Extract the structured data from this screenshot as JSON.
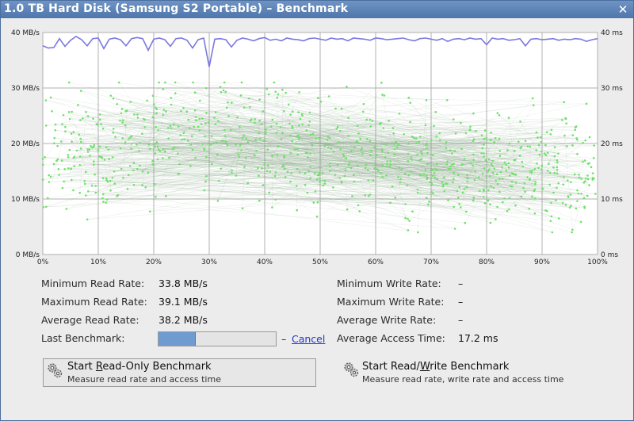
{
  "window": {
    "title": "1.0 TB Hard Disk (Samsung S2 Portable) – Benchmark",
    "close_icon": "close-icon"
  },
  "chart_data": {
    "type": "line",
    "x_ticks": [
      "0%",
      "10%",
      "20%",
      "30%",
      "40%",
      "50%",
      "60%",
      "70%",
      "80%",
      "90%",
      "100%"
    ],
    "y_left_ticks": [
      "0 MB/s",
      "10 MB/s",
      "20 MB/s",
      "30 MB/s",
      "40 MB/s"
    ],
    "y_right_ticks": [
      "0 ms",
      "10 ms",
      "20 ms",
      "30 ms",
      "40 ms"
    ],
    "xlim": [
      0,
      100
    ],
    "ylim_left": [
      0,
      40
    ],
    "ylim_right": [
      0,
      40
    ],
    "grid": true,
    "series": [
      {
        "kind": "read-rate-line",
        "color": "#7a78e0",
        "values": [
          37.6,
          37.2,
          37.3,
          38.9,
          37.5,
          38.6,
          39.3,
          38.7,
          37.6,
          38.9,
          39.0,
          37.1,
          38.8,
          39.0,
          38.7,
          37.6,
          38.9,
          39.1,
          38.9,
          36.8,
          38.8,
          39.0,
          38.7,
          37.5,
          38.9,
          39.0,
          38.6,
          37.2,
          38.7,
          39.0,
          33.8,
          38.8,
          38.9,
          38.7,
          37.4,
          38.6,
          39.0,
          38.8,
          38.5,
          38.9,
          39.1,
          38.6,
          38.8,
          38.5,
          39.0,
          38.8,
          38.7,
          38.5,
          38.9,
          39.0,
          38.8,
          38.6,
          39.0,
          38.8,
          38.9,
          38.5,
          39.0,
          38.9,
          38.8,
          38.6,
          39.0,
          38.9,
          38.7,
          38.8,
          38.9,
          39.0,
          38.7,
          38.5,
          38.9,
          39.0,
          38.8,
          38.6,
          38.9,
          38.4,
          38.8,
          38.9,
          38.7,
          39.0,
          38.8,
          38.9,
          37.8,
          39.0,
          38.8,
          38.9,
          38.6,
          38.7,
          38.9,
          37.6,
          38.8,
          38.9,
          38.7,
          38.8,
          38.9,
          38.6,
          38.8,
          38.7,
          38.9,
          38.8,
          38.4,
          38.7,
          38.9
        ]
      },
      {
        "kind": "access-time-scatter",
        "color": "#6fe06a",
        "description_values": "access times mostly between 8 ms and 30 ms"
      }
    ]
  },
  "stats": {
    "min_read_label": "Minimum Read Rate:",
    "min_read_value": "33.8 MB/s",
    "max_read_label": "Maximum Read Rate:",
    "max_read_value": "39.1 MB/s",
    "avg_read_label": "Average Read Rate:",
    "avg_read_value": "38.2 MB/s",
    "last_bench_label": "Last Benchmark:",
    "last_bench_progress": 0.32,
    "last_bench_dash": "–",
    "cancel_label": "Cancel",
    "min_write_label": "Minimum Write Rate:",
    "min_write_value": "–",
    "max_write_label": "Maximum Write Rate:",
    "max_write_value": "–",
    "avg_write_label": "Average Write Rate:",
    "avg_write_value": "–",
    "avg_access_label": "Average Access Time:",
    "avg_access_value": "17.2 ms"
  },
  "buttons": {
    "read_only": {
      "title_pre": "Start ",
      "title_key": "R",
      "title_post": "ead-Only Benchmark",
      "desc": "Measure read rate and access time",
      "icon": "gears-icon"
    },
    "read_write": {
      "title_pre": "Start Read/",
      "title_key": "W",
      "title_post": "rite Benchmark",
      "desc": "Measure read rate, write rate and access time",
      "icon": "gears-icon"
    }
  }
}
